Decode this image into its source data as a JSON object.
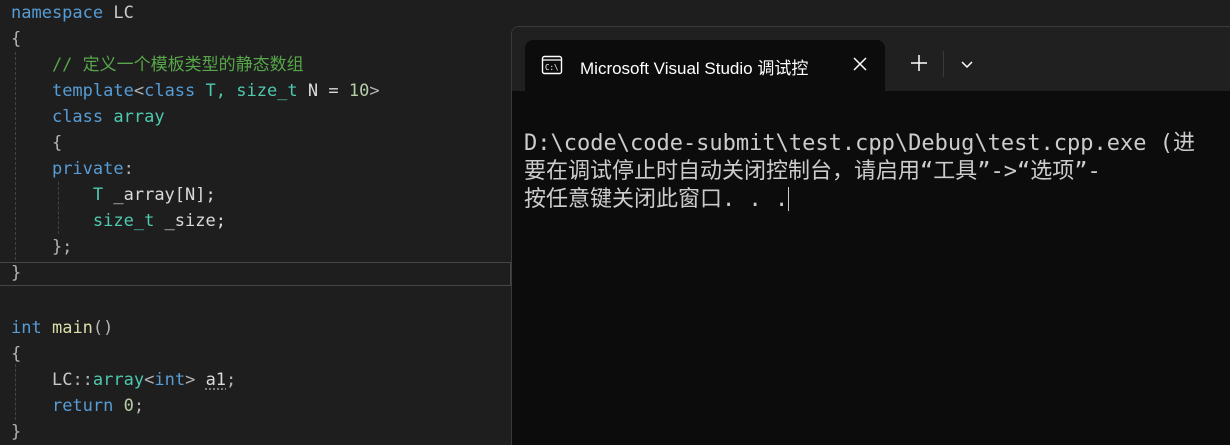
{
  "editor": {
    "lines": [
      {
        "segments": [
          {
            "t": "namespace",
            "c": "kw"
          },
          {
            "t": " LC",
            "c": "lc"
          }
        ]
      },
      {
        "segments": [
          {
            "t": "{",
            "c": "pu"
          }
        ]
      },
      {
        "segments": [
          {
            "t": "    // 定义一个模板类型的静态数组",
            "c": "cm"
          }
        ]
      },
      {
        "segments": [
          {
            "t": "    ",
            "c": "pu"
          },
          {
            "t": "template",
            "c": "kw"
          },
          {
            "t": "<",
            "c": "pu"
          },
          {
            "t": "class",
            "c": "kw"
          },
          {
            "t": " T, ",
            "c": "ty"
          },
          {
            "t": "size_t",
            "c": "ty"
          },
          {
            "t": " N = ",
            "c": "id"
          },
          {
            "t": "10",
            "c": "nm"
          },
          {
            "t": ">",
            "c": "pu"
          }
        ]
      },
      {
        "segments": [
          {
            "t": "    ",
            "c": "pu"
          },
          {
            "t": "class",
            "c": "kw"
          },
          {
            "t": " ",
            "c": "pu"
          },
          {
            "t": "array",
            "c": "ty"
          }
        ]
      },
      {
        "segments": [
          {
            "t": "    {",
            "c": "pu"
          }
        ]
      },
      {
        "segments": [
          {
            "t": "    ",
            "c": "pu"
          },
          {
            "t": "private",
            "c": "kw"
          },
          {
            "t": ":",
            "c": "pu"
          }
        ]
      },
      {
        "segments": [
          {
            "t": "        ",
            "c": "pu"
          },
          {
            "t": "T",
            "c": "ty"
          },
          {
            "t": " _array[N];",
            "c": "id"
          }
        ]
      },
      {
        "segments": [
          {
            "t": "        ",
            "c": "pu"
          },
          {
            "t": "size_t",
            "c": "ty"
          },
          {
            "t": " _size;",
            "c": "id"
          }
        ]
      },
      {
        "segments": [
          {
            "t": "    };",
            "c": "pu"
          }
        ]
      },
      {
        "segments": [
          {
            "t": "}",
            "c": "pu"
          }
        ]
      },
      {
        "segments": []
      },
      {
        "segments": [
          {
            "t": "int",
            "c": "kw"
          },
          {
            "t": " ",
            "c": "pu"
          },
          {
            "t": "main",
            "c": "fn"
          },
          {
            "t": "()",
            "c": "pu"
          }
        ]
      },
      {
        "segments": [
          {
            "t": "{",
            "c": "pu"
          }
        ]
      },
      {
        "segments": [
          {
            "t": "    ",
            "c": "pu"
          },
          {
            "t": "LC",
            "c": "lc"
          },
          {
            "t": "::",
            "c": "pu"
          },
          {
            "t": "array",
            "c": "ty"
          },
          {
            "t": "<",
            "c": "pu"
          },
          {
            "t": "int",
            "c": "kw"
          },
          {
            "t": "> ",
            "c": "pu"
          },
          {
            "t": "a1",
            "c": "id squig"
          },
          {
            "t": ";",
            "c": "pu"
          }
        ]
      },
      {
        "segments": [
          {
            "t": "    ",
            "c": "pu"
          },
          {
            "t": "return",
            "c": "kw"
          },
          {
            "t": " ",
            "c": "pu"
          },
          {
            "t": "0",
            "c": "nm"
          },
          {
            "t": ";",
            "c": "pu"
          }
        ]
      },
      {
        "segments": [
          {
            "t": "}",
            "c": "pu"
          }
        ]
      }
    ]
  },
  "terminal": {
    "tab_title": "Microsoft Visual Studio 调试控",
    "tab_icon": "terminal-icon",
    "lines": [
      "D:\\code\\code-submit\\test.cpp\\Debug\\test.cpp.exe (进",
      "要在调试停止时自动关闭控制台，请启用“工具”->“选项”-",
      "按任意键关闭此窗口. . ."
    ]
  }
}
